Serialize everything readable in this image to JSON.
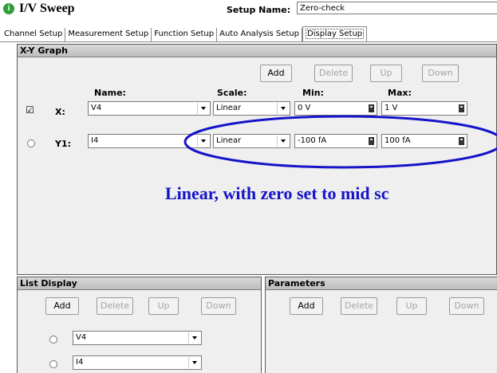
{
  "header": {
    "app_title": "I/V Sweep",
    "setup_name_label": "Setup Name:",
    "setup_name_value": "Zero-check"
  },
  "tabs": [
    {
      "label": "Channel Setup"
    },
    {
      "label": "Measurement Setup"
    },
    {
      "label": "Function Setup"
    },
    {
      "label": "Auto Analysis Setup"
    },
    {
      "label": "Display Setup",
      "active": true
    }
  ],
  "xy_graph": {
    "title": "X-Y Graph",
    "buttons": {
      "add": "Add",
      "delete": "Delete",
      "up": "Up",
      "down": "Down"
    },
    "columns": {
      "name": "Name:",
      "scale": "Scale:",
      "min": "Min:",
      "max": "Max:"
    },
    "rows": [
      {
        "axis": "X:",
        "name": "V4",
        "scale": "Linear",
        "min": "0 V",
        "max": "1 V",
        "checked": true
      },
      {
        "axis": "Y1:",
        "name": "I4",
        "scale": "Linear",
        "min": "-100 fA",
        "max": "100 fA",
        "checked": false
      }
    ],
    "highlight_color": "#1414c8",
    "annotation": "Linear, with zero set to mid sc"
  },
  "list_display": {
    "title": "List Display",
    "buttons": {
      "add": "Add",
      "delete": "Delete",
      "up": "Up",
      "down": "Down"
    },
    "items": [
      {
        "name": "V4"
      },
      {
        "name": "I4"
      }
    ]
  },
  "parameters": {
    "title": "Parameters",
    "buttons": {
      "add": "Add",
      "delete": "Delete",
      "up": "Up",
      "down": "Down"
    }
  }
}
